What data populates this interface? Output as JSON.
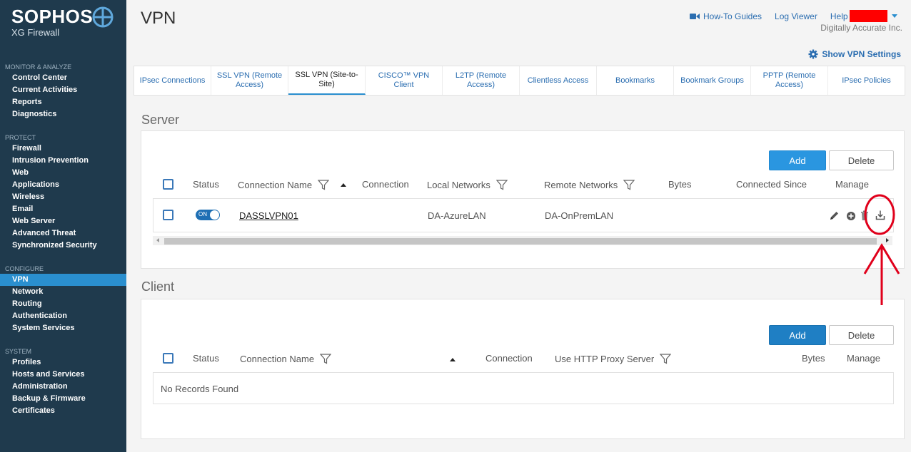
{
  "brand": {
    "name": "SOPHOS",
    "product": "XG Firewall"
  },
  "sidebar": {
    "sections": [
      {
        "heading": "MONITOR & ANALYZE",
        "items": [
          "Control Center",
          "Current Activities",
          "Reports",
          "Diagnostics"
        ]
      },
      {
        "heading": "PROTECT",
        "items": [
          "Firewall",
          "Intrusion Prevention",
          "Web",
          "Applications",
          "Wireless",
          "Email",
          "Web Server",
          "Advanced Threat",
          "Synchronized Security"
        ]
      },
      {
        "heading": "CONFIGURE",
        "items": [
          "VPN",
          "Network",
          "Routing",
          "Authentication",
          "System Services"
        ]
      },
      {
        "heading": "SYSTEM",
        "items": [
          "Profiles",
          "Hosts and Services",
          "Administration",
          "Backup & Firmware",
          "Certificates"
        ]
      }
    ],
    "active_item": "VPN"
  },
  "header": {
    "title": "VPN",
    "howto": "How-To Guides",
    "log_viewer": "Log Viewer",
    "help": "Help",
    "company": "Digitally Accurate Inc.",
    "show_settings": "Show VPN Settings"
  },
  "tabs": [
    {
      "label": "IPsec Connections",
      "active": false
    },
    {
      "label": "SSL VPN (Remote Access)",
      "active": false
    },
    {
      "label": "SSL VPN (Site-to-Site)",
      "active": true
    },
    {
      "label": "CISCO™ VPN Client",
      "active": false
    },
    {
      "label": "L2TP (Remote Access)",
      "active": false
    },
    {
      "label": "Clientless Access",
      "active": false
    },
    {
      "label": "Bookmarks",
      "active": false
    },
    {
      "label": "Bookmark Groups",
      "active": false
    },
    {
      "label": "PPTP (Remote Access)",
      "active": false
    },
    {
      "label": "IPsec Policies",
      "active": false
    }
  ],
  "server": {
    "title": "Server",
    "add": "Add",
    "delete": "Delete",
    "columns": {
      "status": "Status",
      "name": "Connection Name",
      "connection": "Connection",
      "local": "Local Networks",
      "remote": "Remote Networks",
      "bytes": "Bytes",
      "since": "Connected Since",
      "manage": "Manage"
    },
    "rows": [
      {
        "toggle": "ON",
        "name": "DASSLVPN01",
        "local": "DA-AzureLAN",
        "remote": "DA-OnPremLAN"
      }
    ]
  },
  "client": {
    "title": "Client",
    "add": "Add",
    "delete": "Delete",
    "columns": {
      "status": "Status",
      "name": "Connection Name",
      "connection": "Connection",
      "proxy": "Use HTTP Proxy Server",
      "bytes": "Bytes",
      "manage": "Manage"
    },
    "empty": "No Records Found"
  },
  "colors": {
    "sidebar_bg": "#1f3a4d",
    "accent": "#2a96e0",
    "annotation": "#e0001b"
  }
}
